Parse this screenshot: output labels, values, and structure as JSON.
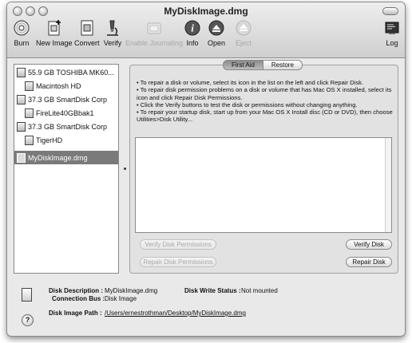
{
  "window": {
    "title": "MyDiskImage.dmg"
  },
  "toolbar": {
    "burn": "Burn",
    "new_image": "New Image",
    "convert": "Convert",
    "verify": "Verify",
    "enable_journaling": "Enable Journaling",
    "info": "Info",
    "open": "Open",
    "eject": "Eject",
    "log": "Log"
  },
  "sidebar": {
    "items": [
      {
        "label": "55.9 GB TOSHIBA MK60..."
      },
      {
        "label": "Macintosh HD"
      },
      {
        "label": "37.3 GB SmartDisk Corp"
      },
      {
        "label": "FireLite40GBbak1"
      },
      {
        "label": "37.3 GB SmartDisk Corp"
      },
      {
        "label": "TigerHD"
      },
      {
        "label": "MyDiskImage.dmg"
      }
    ]
  },
  "tabs": {
    "first_aid": "First Aid",
    "restore": "Restore"
  },
  "first_aid": {
    "instructions": [
      "• To repair a disk or volume, select its icon in the list on the left and click Repair Disk.",
      "• To repair disk permission problems on a disk or volume that has Mac OS X installed, select its icon and click Repair Disk Permissions.",
      "• Click the Verify buttons to test the disk or permissions without changing anything.",
      "• To repair your startup disk, start up from your Mac OS X Install disc (CD or DVD), then choose Utilities>Disk Utility..."
    ],
    "verify_permissions": "Verify Disk Permissions",
    "repair_permissions": "Repair Disk Permissions",
    "verify_disk": "Verify Disk",
    "repair_disk": "Repair Disk"
  },
  "info": {
    "description_label": "Disk Description :",
    "description_value": "MyDiskImage.dmg",
    "connection_label": "Connection Bus :",
    "connection_value": "Disk Image",
    "write_status_label": "Disk Write Status :",
    "write_status_value": "Not mounted",
    "path_label": "Disk Image Path :",
    "path_value": "/Users/ernestrothman/Desktop/MyDiskImage.dmg",
    "help": "?"
  }
}
